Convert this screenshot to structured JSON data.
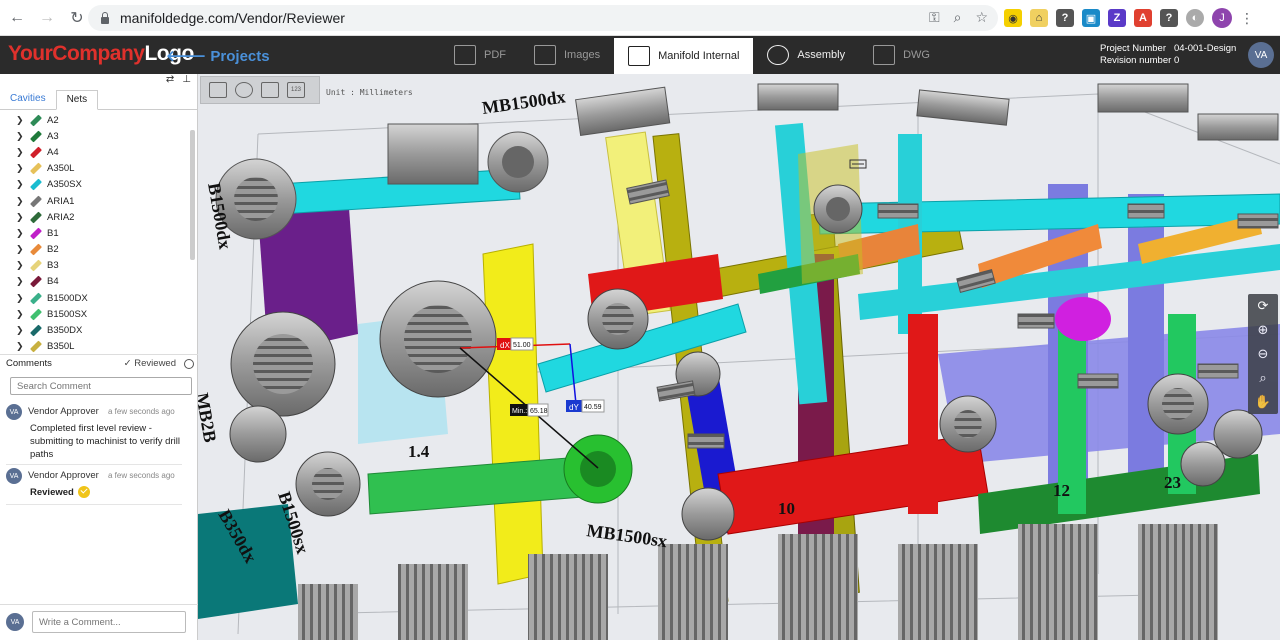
{
  "browser": {
    "url": "manifoldedge.com/Vendor/Reviewer",
    "profile_initial": "J"
  },
  "header": {
    "logo_part1": "YourCompany",
    "logo_part2": "Logo",
    "projects_label": "Projects",
    "tabs": [
      {
        "label": "PDF",
        "icon": "pdf-icon",
        "active": false
      },
      {
        "label": "Images",
        "icon": "images-icon",
        "active": false
      },
      {
        "label": "Manifold Internal",
        "icon": "manifold-icon",
        "active": true
      },
      {
        "label": "Assembly",
        "icon": "assembly-icon",
        "active": false
      },
      {
        "label": "DWG",
        "icon": "dwg-icon",
        "active": false
      }
    ],
    "project_number_label": "Project Number",
    "project_number_value": "04-001-Design",
    "revision_label": "Revision number",
    "revision_value": "0",
    "user_initials": "VA"
  },
  "left_panel": {
    "tabs": [
      "Cavities",
      "Nets"
    ],
    "active_tab": "Nets",
    "nets": [
      {
        "label": "A2",
        "color": "#2e8b57"
      },
      {
        "label": "A3",
        "color": "#1f7a3a"
      },
      {
        "label": "A4",
        "color": "#d0202a"
      },
      {
        "label": "A350L",
        "color": "#e6c15a"
      },
      {
        "label": "A350SX",
        "color": "#1abcd0"
      },
      {
        "label": "ARIA1",
        "color": "#777777"
      },
      {
        "label": "ARIA2",
        "color": "#2e6b3a"
      },
      {
        "label": "B1",
        "color": "#c020c8"
      },
      {
        "label": "B2",
        "color": "#e88a3a"
      },
      {
        "label": "B3",
        "color": "#e6d37a"
      },
      {
        "label": "B4",
        "color": "#7a1a3a"
      },
      {
        "label": "B1500DX",
        "color": "#3ab08a"
      },
      {
        "label": "B1500SX",
        "color": "#40c070"
      },
      {
        "label": "B350DX",
        "color": "#1a6a6a"
      },
      {
        "label": "B350L",
        "color": "#c8b040"
      }
    ],
    "comments_title": "Comments",
    "reviewed_label": "Reviewed",
    "search_placeholder": "Search Comment",
    "comments": [
      {
        "initials": "VA",
        "author": "Vendor Approver",
        "time": "a few seconds ago",
        "text": "Completed first level review - submitting to machinist to verify drill paths"
      },
      {
        "initials": "VA",
        "author": "Vendor Approver",
        "time": "a few seconds ago",
        "text": "Reviewed"
      }
    ],
    "write_placeholder": "Write a Comment...",
    "write_initials": "VA"
  },
  "viewport": {
    "unit_label": "Unit : Millimeters",
    "tool_count_badge": "123",
    "labels": {
      "mb1500dx": "MB1500dx",
      "mb1500sx": "MB1500sx",
      "b1500dx": "B1500dx",
      "b1500sx": "B1500sx",
      "b350dx": "B350dx",
      "mb2b": "MB2B",
      "n14": "1.4",
      "n10": "10",
      "n12": "12",
      "n23": "23"
    },
    "measure": {
      "dx_label": "dX",
      "dx_value": "51.00",
      "dy_label": "dY",
      "dy_value": "40.59",
      "min_label": "Min.:",
      "min_value": "65.18"
    }
  }
}
